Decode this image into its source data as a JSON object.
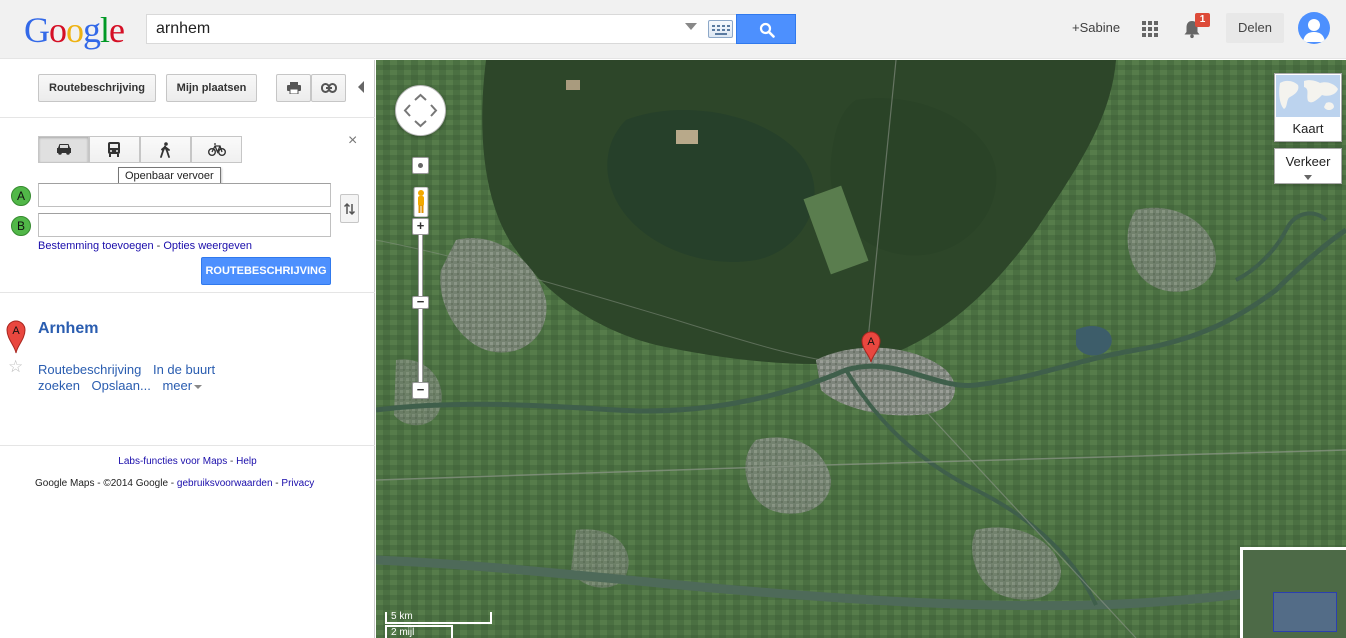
{
  "header": {
    "logo": [
      "G",
      "o",
      "o",
      "g",
      "l",
      "e"
    ],
    "logo_colors": [
      "#3369e8",
      "#d50f25",
      "#eeb211",
      "#3369e8",
      "#009925",
      "#d50f25"
    ],
    "search_value": "arnhem",
    "user_link": "+Sabine",
    "notification_count": "1",
    "share_label": "Delen",
    "icons": [
      "keyboard-icon",
      "search-icon",
      "apps-icon",
      "bell-icon",
      "avatar-icon"
    ]
  },
  "panel": {
    "route_button": "Routebeschrijving",
    "places_button": "Mijn plaatsen",
    "travel_modes": [
      "car",
      "transit",
      "walking",
      "bicycle"
    ],
    "active_mode": "car",
    "tooltip": "Openbaar vervoer",
    "close_symbol": "×",
    "marker_a": "A",
    "marker_b": "B",
    "input_a_value": "",
    "input_b_value": "",
    "add_destination": "Bestemming toevoegen",
    "link_separator": " - ",
    "show_options": "Opties weergeven",
    "submit_button": "ROUTEBESCHRIJVING"
  },
  "result": {
    "pin_letter": "A",
    "title": "Arnhem",
    "star": "☆",
    "link_route": "Routebeschrijving",
    "link_nearby": "In de buurt zoeken",
    "link_save": "Opslaan...",
    "link_more": "meer"
  },
  "footer": {
    "labs": "Labs-functies voor Maps",
    "sep": " - ",
    "help": "Help",
    "copyright": "Google Maps   - ©2014 Google  - ",
    "terms": "gebruiksvoorwaarden",
    "sep2": " - ",
    "privacy": "Privacy"
  },
  "map": {
    "view": "satellite",
    "pin_letter": "A",
    "zoom_in": "+",
    "zoom_out": "−",
    "layer_map_label": "Kaart",
    "traffic_label": "Verkeer",
    "scale_km": "5 km",
    "scale_mi": "2 mijl",
    "colors": {
      "forest": "#2f4a2a",
      "farmland": "#4e7a45",
      "urban": "#8a8f88",
      "river": "#5f7a6a"
    }
  }
}
